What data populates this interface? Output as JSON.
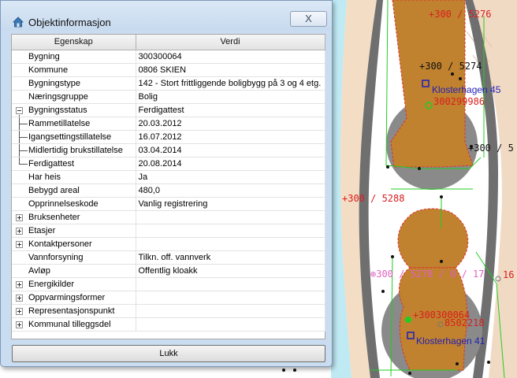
{
  "dialog": {
    "title": "Objektinformasjon",
    "close_label": "X",
    "ok_label": "Lukk",
    "columns": [
      "Egenskap",
      "Verdi"
    ],
    "rows": [
      {
        "name": "Bygning",
        "value": "300300064",
        "level": 0,
        "expander": "none"
      },
      {
        "name": "Kommune",
        "value": "0806  SKIEN",
        "level": 0,
        "expander": "none"
      },
      {
        "name": "Bygningstype",
        "value": "142 - Stort frittliggende boligbygg på 3 og 4 etg.",
        "level": 0,
        "expander": "none"
      },
      {
        "name": "Næringsgruppe",
        "value": "Bolig",
        "level": 0,
        "expander": "none"
      },
      {
        "name": "Bygningsstatus",
        "value": "Ferdigattest",
        "level": 0,
        "expander": "minus"
      },
      {
        "name": "Rammetillatelse",
        "value": "20.03.2012",
        "level": 1,
        "expander": "none"
      },
      {
        "name": "Igangsettingstillatelse",
        "value": "16.07.2012",
        "level": 1,
        "expander": "none"
      },
      {
        "name": "Midlertidig brukstillatelse",
        "value": "03.04.2014",
        "level": 1,
        "expander": "none"
      },
      {
        "name": "Ferdigattest",
        "value": "20.08.2014",
        "level": 1,
        "expander": "none",
        "last": true
      },
      {
        "name": "Har heis",
        "value": "Ja",
        "level": 0,
        "expander": "none"
      },
      {
        "name": "Bebygd areal",
        "value": "480,0",
        "level": 0,
        "expander": "none"
      },
      {
        "name": "Opprinnelseskode",
        "value": "Vanlig registrering",
        "level": 0,
        "expander": "none"
      },
      {
        "name": "Bruksenheter",
        "value": "",
        "level": 0,
        "expander": "plus"
      },
      {
        "name": "Etasjer",
        "value": "",
        "level": 0,
        "expander": "plus"
      },
      {
        "name": "Kontaktpersoner",
        "value": "",
        "level": 0,
        "expander": "plus"
      },
      {
        "name": "Vannforsyning",
        "value": "Tilkn. off. vannverk",
        "level": 0,
        "expander": "none"
      },
      {
        "name": "Avløp",
        "value": "Offentlig kloakk",
        "level": 0,
        "expander": "none"
      },
      {
        "name": "Energikilder",
        "value": "",
        "level": 0,
        "expander": "plus"
      },
      {
        "name": "Oppvarmingsformer",
        "value": "",
        "level": 0,
        "expander": "plus"
      },
      {
        "name": "Representasjonspunkt",
        "value": "",
        "level": 0,
        "expander": "plus"
      },
      {
        "name": "Kommunal tilleggsdel",
        "value": "",
        "level": 0,
        "expander": "plus"
      }
    ]
  },
  "map": {
    "colors": {
      "building": "#c0822f",
      "building_outline": "#e03030",
      "circle": "#8c8c8c",
      "road": "#6e6e6e",
      "terrain": "#f0dcc8",
      "water": "#bfeaf4",
      "property_line": "#22cc22",
      "label_red": "#d81e1e",
      "label_blue": "#1f1fb8",
      "label_black": "#111111",
      "label_pink": "#e060c0"
    },
    "labels": {
      "parcel_5276": "300 / 5276",
      "parcel_5274": "300 / 5274",
      "klosterhagen_45": "Klosterhagen 45",
      "building_id_top": "300299986",
      "parcel_partial_right": "300 / 5",
      "parcel_5288": "300 / 5288",
      "section_5278": "300 / 5278 / 0 / 17",
      "edge_number": "16",
      "building_id_bottom": "300300064",
      "other_id": "8502218",
      "klosterhagen_41": "Klosterhagen 41"
    }
  }
}
